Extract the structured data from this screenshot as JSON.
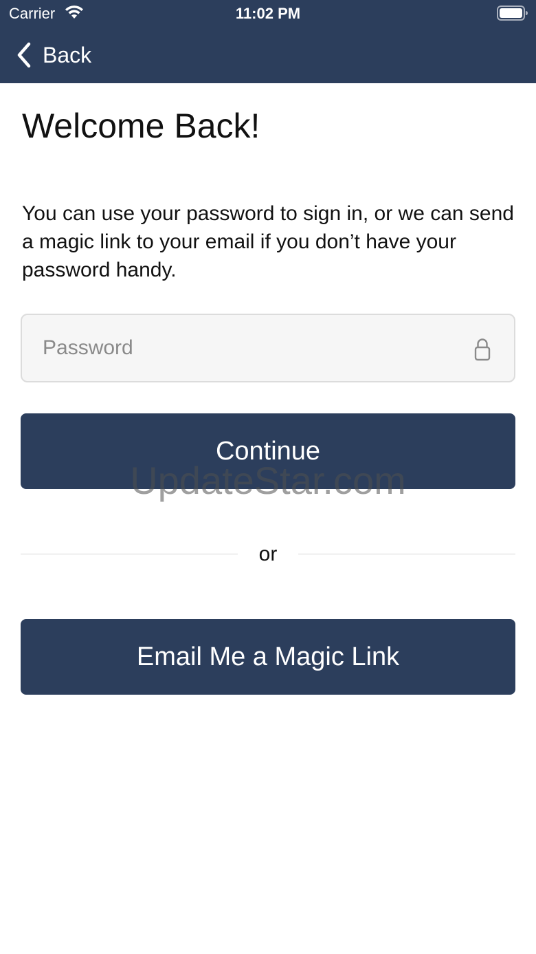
{
  "status_bar": {
    "carrier": "Carrier",
    "time": "11:02 PM",
    "wifi_icon": "wifi-icon",
    "battery_icon": "battery-icon"
  },
  "nav": {
    "back_label": "Back",
    "back_icon": "chevron-left-icon"
  },
  "page": {
    "title": "Welcome Back!",
    "description": "You can use your password to sign in, or we can send a magic link to your email if you don’t have your password handy."
  },
  "password_field": {
    "placeholder": "Password",
    "value": "",
    "icon": "lock-icon"
  },
  "buttons": {
    "continue_label": "Continue",
    "magic_link_label": "Email Me a Magic Link"
  },
  "divider": {
    "text": "or"
  },
  "watermark": "UpdateStar.com",
  "colors": {
    "primary": "#2c3e5c",
    "field_background": "#f6f6f6",
    "field_border": "#dcdcdc"
  }
}
